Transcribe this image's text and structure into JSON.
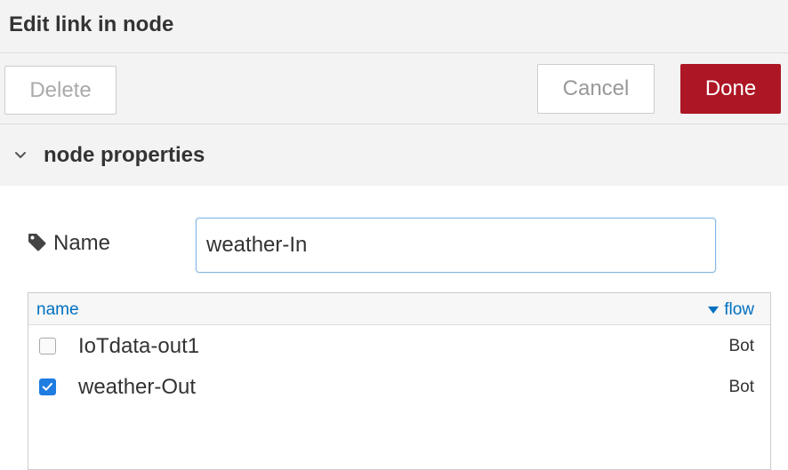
{
  "dialog": {
    "title": "Edit link in node"
  },
  "toolbar": {
    "delete_label": "Delete",
    "cancel_label": "Cancel",
    "done_label": "Done"
  },
  "section": {
    "title": "node properties"
  },
  "name_field": {
    "label": "Name",
    "value": "weather-In"
  },
  "link_table": {
    "columns": {
      "name": "name",
      "flow": "flow"
    },
    "rows": [
      {
        "name": "IoTdata-out1",
        "flow": "Bot",
        "checked": false
      },
      {
        "name": "weather-Out",
        "flow": "Bot",
        "checked": true
      }
    ]
  },
  "colors": {
    "done_button": "#ad1625",
    "header_bg": "#f3f3f3",
    "link_blue": "#0070c0",
    "checkbox_checked": "#1f7ce0"
  },
  "icons": {
    "section_toggle": "chevron-down-icon",
    "name_label": "tag-icon",
    "sort_indicator": "caret-down-icon"
  }
}
